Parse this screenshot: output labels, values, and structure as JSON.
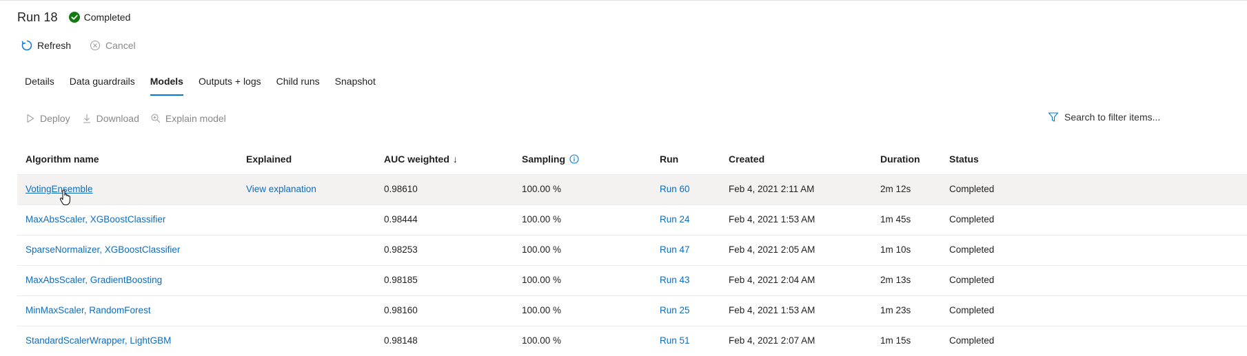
{
  "header": {
    "title": "Run 18",
    "status": "Completed"
  },
  "commands": {
    "refresh": "Refresh",
    "cancel": "Cancel"
  },
  "tabs": [
    {
      "label": "Details"
    },
    {
      "label": "Data guardrails"
    },
    {
      "label": "Models",
      "active": true
    },
    {
      "label": "Outputs + logs"
    },
    {
      "label": "Child runs"
    },
    {
      "label": "Snapshot"
    }
  ],
  "toolbar": {
    "deploy": "Deploy",
    "download": "Download",
    "explain": "Explain model"
  },
  "search": {
    "placeholder": "Search to filter items..."
  },
  "table": {
    "columns": {
      "algorithm": "Algorithm name",
      "explained": "Explained",
      "auc": "AUC weighted",
      "auc_sort": "↓",
      "sampling": "Sampling",
      "run": "Run",
      "created": "Created",
      "duration": "Duration",
      "status": "Status"
    },
    "rows": [
      {
        "algorithm": "VotingEnsemble",
        "explained": "View explanation",
        "auc": "0.98610",
        "sampling": "100.00 %",
        "run": "Run 60",
        "created": "Feb 4, 2021 2:11 AM",
        "duration": "2m 12s",
        "status": "Completed"
      },
      {
        "algorithm": "MaxAbsScaler, XGBoostClassifier",
        "explained": "",
        "auc": "0.98444",
        "sampling": "100.00 %",
        "run": "Run 24",
        "created": "Feb 4, 2021 1:53 AM",
        "duration": "1m 45s",
        "status": "Completed"
      },
      {
        "algorithm": "SparseNormalizer, XGBoostClassifier",
        "explained": "",
        "auc": "0.98253",
        "sampling": "100.00 %",
        "run": "Run 47",
        "created": "Feb 4, 2021 2:05 AM",
        "duration": "1m 10s",
        "status": "Completed"
      },
      {
        "algorithm": "MaxAbsScaler, GradientBoosting",
        "explained": "",
        "auc": "0.98185",
        "sampling": "100.00 %",
        "run": "Run 43",
        "created": "Feb 4, 2021 2:04 AM",
        "duration": "2m 13s",
        "status": "Completed"
      },
      {
        "algorithm": "MinMaxScaler, RandomForest",
        "explained": "",
        "auc": "0.98160",
        "sampling": "100.00 %",
        "run": "Run 25",
        "created": "Feb 4, 2021 1:53 AM",
        "duration": "1m 23s",
        "status": "Completed"
      },
      {
        "algorithm": "StandardScalerWrapper, LightGBM",
        "explained": "",
        "auc": "0.98148",
        "sampling": "100.00 %",
        "run": "Run 51",
        "created": "Feb 4, 2021 2:07 AM",
        "duration": "1m 15s",
        "status": "Completed"
      }
    ]
  },
  "colors": {
    "accent": "#0078d4",
    "link": "#0f6cbd",
    "success": "#107c10",
    "disabled": "#8a8886"
  },
  "icons": [
    "check-circle-icon",
    "refresh-icon",
    "cancel-icon",
    "deploy-icon",
    "download-icon",
    "explain-icon",
    "filter-icon",
    "info-icon",
    "hand-cursor-icon"
  ]
}
